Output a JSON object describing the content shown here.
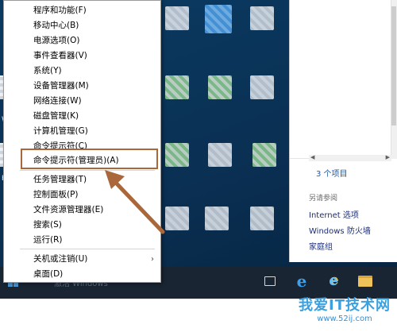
{
  "menu": {
    "items": [
      {
        "label": "程序和功能(F)"
      },
      {
        "label": "移动中心(B)"
      },
      {
        "label": "电源选项(O)"
      },
      {
        "label": "事件查看器(V)"
      },
      {
        "label": "系统(Y)"
      },
      {
        "label": "设备管理器(M)"
      },
      {
        "label": "网络连接(W)"
      },
      {
        "label": "磁盘管理(K)"
      },
      {
        "label": "计算机管理(G)"
      },
      {
        "label": "命令提示符(C)"
      },
      {
        "label": "命令提示符(管理员)(A)"
      },
      {
        "label": "任务管理器(T)"
      },
      {
        "label": "控制面板(P)"
      },
      {
        "label": "文件资源管理器(E)"
      },
      {
        "label": "搜索(S)"
      },
      {
        "label": "运行(R)"
      },
      {
        "label": "关机或注销(U)"
      },
      {
        "label": "桌面(D)"
      }
    ],
    "highlighted_index": 10,
    "submenu_arrow": "›"
  },
  "explorer": {
    "status": "3 个项目",
    "see_also": "另请参阅",
    "links": [
      "Internet 选项",
      "Windows 防火墙",
      "家庭组"
    ]
  },
  "desktop": {
    "edge_labels": [
      "W",
      "Ke"
    ]
  },
  "taskbar": {
    "watermark": "激活 Windows",
    "icons": [
      "task-view-icon",
      "edge-icon",
      "ie-icon",
      "file-explorer-icon"
    ]
  },
  "watermark": {
    "title": "我爱IT技术网",
    "url": "www.52ij.com"
  },
  "colors": {
    "highlight_border": "#a9673a",
    "arrow": "#a9673a",
    "taskbar": "#1a2533",
    "link": "#1b2d7a"
  }
}
